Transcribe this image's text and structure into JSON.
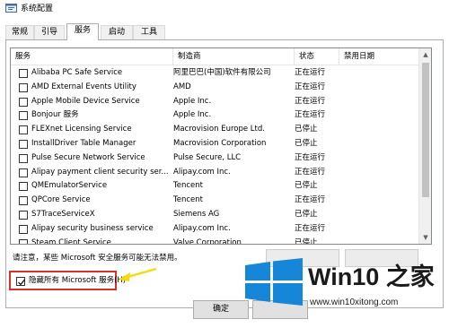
{
  "window": {
    "title": "系统配置"
  },
  "tabs": [
    {
      "label": "常规"
    },
    {
      "label": "引导"
    },
    {
      "label": "服务"
    },
    {
      "label": "启动"
    },
    {
      "label": "工具"
    }
  ],
  "active_tab": "服务",
  "columns": {
    "service": "服务",
    "manufacturer": "制造商",
    "status": "状态",
    "disabled_date": "禁用日期"
  },
  "services": [
    {
      "name": "Alibaba PC Safe Service",
      "manufacturer": "阿里巴巴(中国)软件有限公司",
      "status": "正在运行",
      "checked": false
    },
    {
      "name": "AMD External Events Utility",
      "manufacturer": "AMD",
      "status": "正在运行",
      "checked": false
    },
    {
      "name": "Apple Mobile Device Service",
      "manufacturer": "Apple Inc.",
      "status": "正在运行",
      "checked": false
    },
    {
      "name": "Bonjour 服务",
      "manufacturer": "Apple Inc.",
      "status": "正在运行",
      "checked": false
    },
    {
      "name": "FLEXnet Licensing Service",
      "manufacturer": "Macrovision Europe Ltd.",
      "status": "已停止",
      "checked": false
    },
    {
      "name": "InstallDriver Table Manager",
      "manufacturer": "Macrovision Corporation",
      "status": "已停止",
      "checked": false
    },
    {
      "name": "Pulse Secure Network Service",
      "manufacturer": "Pulse Secure, LLC",
      "status": "正在运行",
      "checked": false
    },
    {
      "name": "Alipay payment client security ser...",
      "manufacturer": "Alipay.com Inc.",
      "status": "正在运行",
      "checked": false
    },
    {
      "name": "QMEmulatorService",
      "manufacturer": "Tencent",
      "status": "已停止",
      "checked": false
    },
    {
      "name": "QPCore Service",
      "manufacturer": "Tencent",
      "status": "正在运行",
      "checked": false
    },
    {
      "name": "S7TraceServiceX",
      "manufacturer": "Siemens AG",
      "status": "已停止",
      "checked": false
    },
    {
      "name": "Alipay security business service",
      "manufacturer": "Alipay.com Inc.",
      "status": "正在运行",
      "checked": false
    },
    {
      "name": "Steam Client Service",
      "manufacturer": "Valve Corporation",
      "status": "已停止",
      "checked": false
    }
  ],
  "notice": "请注意，某些 Microsoft 安全服务可能无法禁用。",
  "hide_ms": {
    "label": "隐藏所有 Microsoft 服务(H)",
    "checked": true
  },
  "buttons": {
    "ok": "确定"
  },
  "watermark": {
    "title": "Win10 之家",
    "url": "www.win10xitong.com"
  },
  "colors": {
    "highlight_box": "#d9302b",
    "arrow": "#f5d90a",
    "logo_blue": "#1686d9"
  }
}
